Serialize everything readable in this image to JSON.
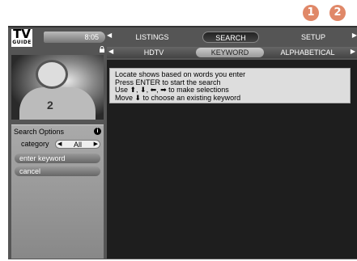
{
  "callouts": [
    "1",
    "2"
  ],
  "logo": {
    "main": "TV",
    "sub": "GUIDE"
  },
  "clock": "8:05",
  "top_nav": {
    "tabs": [
      "LISTINGS",
      "SEARCH",
      "SETUP"
    ],
    "active": "SEARCH"
  },
  "sub_nav": {
    "tabs": [
      "HDTV",
      "KEYWORD",
      "ALPHABETICAL"
    ],
    "active": "KEYWORD"
  },
  "sidebar": {
    "title": "Search Options",
    "category_label": "category",
    "category_value": "All",
    "buttons": [
      "enter keyword",
      "cancel"
    ]
  },
  "instructions": [
    "Locate shows based on words you enter",
    "Press ENTER to start the search",
    "Use ⬆, ⬇, ⬅, ➡ to make selections",
    "Move ⬇ to choose an existing keyword"
  ],
  "preview": {
    "jersey_number": "2"
  },
  "colors": {
    "callout": "#e08868",
    "background": "#555555",
    "content": "#1e1e1e"
  }
}
